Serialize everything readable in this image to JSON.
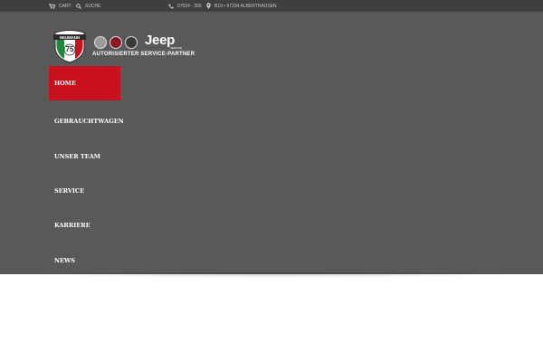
{
  "topbar": {
    "cart_label": "CART",
    "search_label": "SUCHE",
    "phone": "07024 - 355",
    "address": "B19 • 97234 ALBERTHAUSEN"
  },
  "logo": {
    "dealer_name": "NEUMANN",
    "years": "75",
    "jeep_label": "Jeep",
    "jeep_sub": "SERVICE",
    "partner_label": "AUTORISIERTER SERVICE-PARTNER",
    "brands": [
      "alfa-romeo",
      "fiat",
      "abarth",
      "jeep"
    ]
  },
  "nav": {
    "items": [
      {
        "label": "HOME",
        "active": true
      },
      {
        "label": "GEBRAUCHTWAGEN",
        "active": false
      },
      {
        "label": "UNSER TEAM",
        "active": false
      },
      {
        "label": "SERVICE",
        "active": false
      },
      {
        "label": "KARRIERE",
        "active": false
      },
      {
        "label": "NEWS",
        "active": false
      }
    ]
  },
  "colors": {
    "topbar_bg": "#3f3f3f",
    "header_bg": "#595959",
    "accent": "#c8101e",
    "text": "#ffffff"
  }
}
